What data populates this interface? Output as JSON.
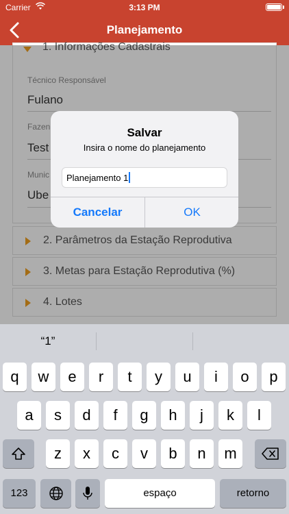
{
  "status_bar": {
    "carrier": "Carrier",
    "time": "3:13 PM"
  },
  "nav": {
    "title": "Planejamento"
  },
  "form": {
    "section1": "1. Informações Cadastrais",
    "fields": [
      {
        "label": "Técnico Responsável",
        "value": "Fulano"
      },
      {
        "label": "Fazen",
        "value": "Test"
      },
      {
        "label": "Munic",
        "value": "Ube"
      }
    ],
    "sections": [
      "2. Parâmetros da Estação Reprodutiva",
      "3. Metas para Estação Reprodutiva (%)",
      "4. Lotes"
    ]
  },
  "alert": {
    "title": "Salvar",
    "message": "Insira o nome do planejamento",
    "input_value": "Planejamento 1",
    "cancel_label": "Cancelar",
    "ok_label": "OK"
  },
  "keyboard": {
    "suggestion": "“1”",
    "row1": [
      "q",
      "w",
      "e",
      "r",
      "t",
      "y",
      "u",
      "i",
      "o",
      "p"
    ],
    "row2": [
      "a",
      "s",
      "d",
      "f",
      "g",
      "h",
      "j",
      "k",
      "l"
    ],
    "row3": [
      "z",
      "x",
      "c",
      "v",
      "b",
      "n",
      "m"
    ],
    "numbers_label": "123",
    "space_label": "espaço",
    "return_label": "retorno"
  },
  "colors": {
    "brand": "#c8432f",
    "accent": "#f0a020",
    "link": "#1479fb"
  },
  "icons": {
    "back": "chevron-left-icon",
    "shift": "shift-icon",
    "delete": "delete-icon",
    "globe": "globe-icon",
    "mic": "microphone-icon",
    "wifi": "wifi-icon",
    "battery": "battery-icon"
  }
}
